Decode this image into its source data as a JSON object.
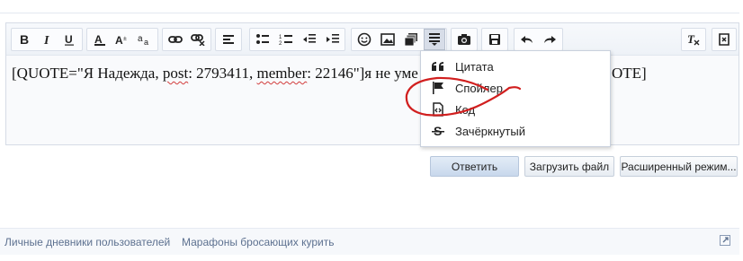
{
  "editor": {
    "content": {
      "part1": "[QUOTE=\"Я Надежда, ",
      "word_post": "post",
      "part2": ": 2793411, ",
      "word_member": "member",
      "part3": ": 22146\"]я не уме",
      "tail": "OTE]"
    }
  },
  "toolbar": {
    "buttons": [
      "bold",
      "italic",
      "underline",
      "text-color",
      "text-size",
      "font",
      "link",
      "unlink",
      "align-left",
      "bullet-list",
      "numbered-list",
      "outdent",
      "indent",
      "smilie",
      "image",
      "media",
      "more-insert",
      "camera",
      "save-draft",
      "undo",
      "redo",
      "remove-format",
      "toggle-bbcode"
    ],
    "active": "more-insert"
  },
  "dropdown": {
    "items": [
      {
        "label": "Цитата",
        "icon": "quote-icon"
      },
      {
        "label": "Спойлер",
        "icon": "flag-icon"
      },
      {
        "label": "Код",
        "icon": "code-file-icon"
      },
      {
        "label": "Зачёркнутый",
        "icon": "strikethrough-icon"
      }
    ]
  },
  "actions": {
    "reply": "Ответить",
    "upload": "Загрузить файл",
    "advanced": "Расширенный режим..."
  },
  "footer": {
    "links": [
      "Личные дневники пользователей",
      "Марафоны бросающих курить"
    ]
  },
  "colors": {
    "annotation": "#d11f1f",
    "link": "#5d7190",
    "primary_button": "#c8d8ec"
  }
}
